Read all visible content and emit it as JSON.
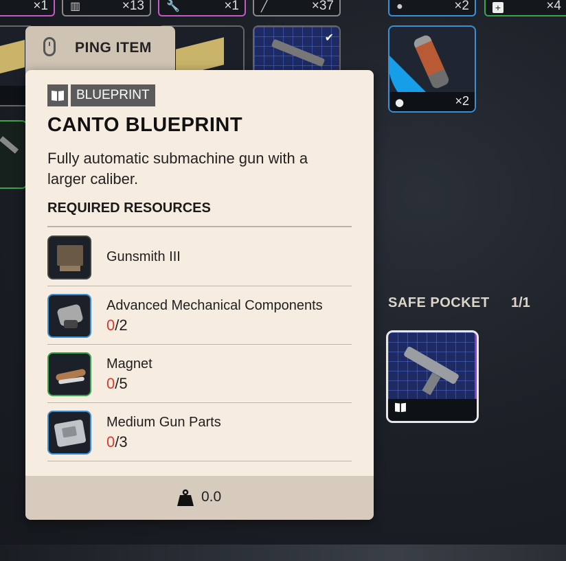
{
  "top_slots": [
    {
      "count": "×1",
      "icon": "item-icon"
    },
    {
      "count": "×13",
      "icon": "ammo-icon"
    },
    {
      "count": "×1",
      "icon": "wrench-icon"
    },
    {
      "count": "×37",
      "icon": "syringe-icon"
    },
    {
      "count": "×2",
      "icon": "grenade-icon"
    },
    {
      "count": "×4",
      "icon": "medkit-icon"
    }
  ],
  "grenade_slot": {
    "count": "×2"
  },
  "ping": {
    "label": "PING ITEM"
  },
  "tooltip": {
    "category": "BLUEPRINT",
    "title": "CANTO BLUEPRINT",
    "description": "Fully automatic submachine gun with a larger caliber.",
    "requirements_heading": "REQUIRED RESOURCES",
    "resources": [
      {
        "name": "Gunsmith III",
        "have": "",
        "need": "",
        "border": "#444444"
      },
      {
        "name": "Advanced Mechanical Components",
        "have": "0",
        "need": "/2",
        "border": "#3b8fd6"
      },
      {
        "name": "Magnet",
        "have": "0",
        "need": "/5",
        "border": "#3aa64b"
      },
      {
        "name": "Medium Gun Parts",
        "have": "0",
        "need": "/3",
        "border": "#3b8fd6"
      }
    ],
    "weight": "0.0"
  },
  "safe_pocket": {
    "label": "SAFE POCKET",
    "count": "1/1"
  },
  "colors": {
    "missing": "#e2362a",
    "tooltip_bg": "#f6ece0",
    "footer_bg": "#d6cbbd"
  }
}
